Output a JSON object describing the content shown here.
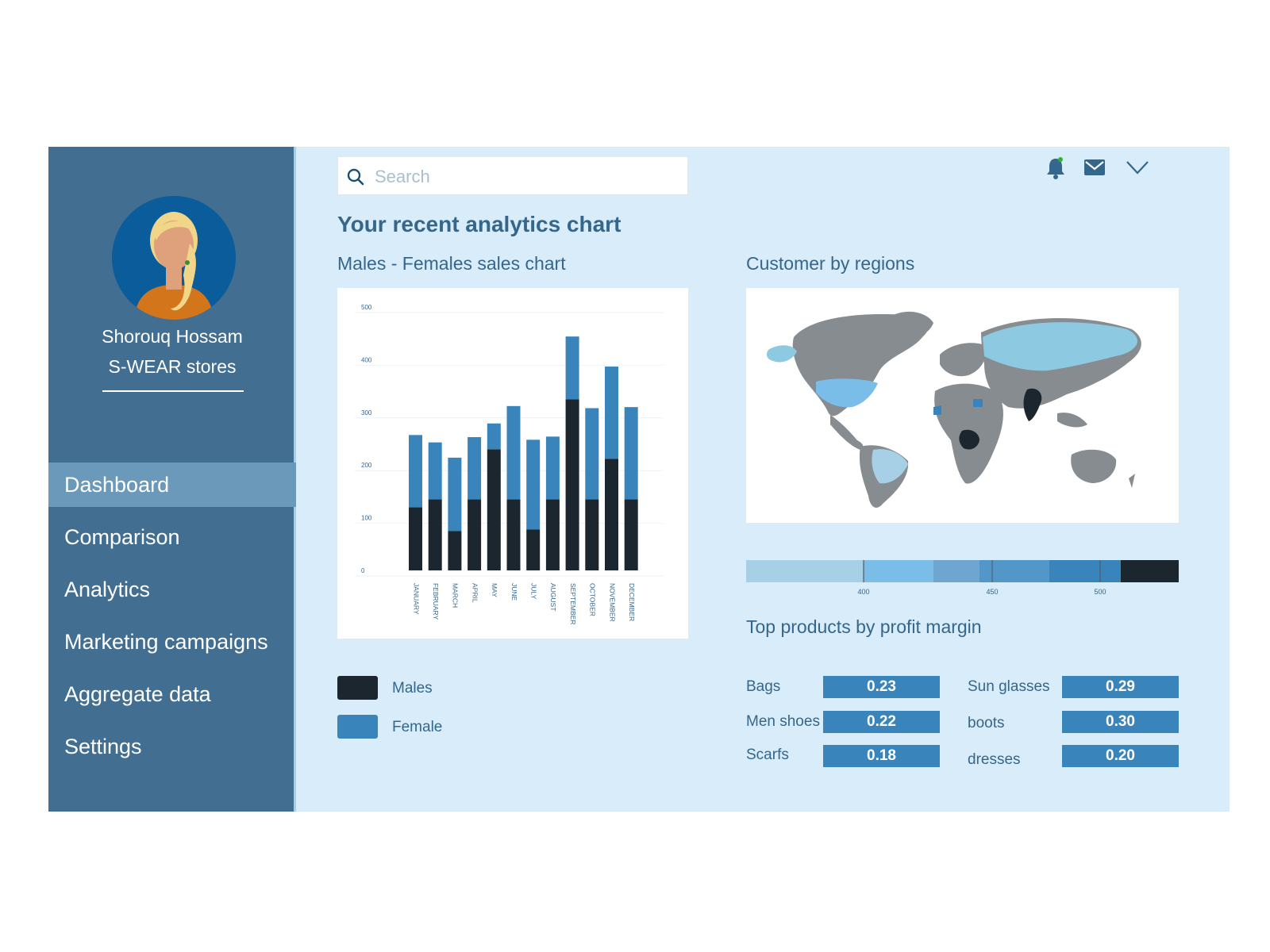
{
  "user": {
    "name": "Shorouq Hossam",
    "store": "S-WEAR stores"
  },
  "nav": {
    "items": [
      {
        "label": "Dashboard",
        "active": true
      },
      {
        "label": "Comparison",
        "active": false
      },
      {
        "label": "Analytics",
        "active": false
      },
      {
        "label": "Marketing campaigns",
        "active": false
      },
      {
        "label": "Aggregate data",
        "active": false
      },
      {
        "label": "Settings",
        "active": false
      }
    ]
  },
  "search": {
    "placeholder": "Search",
    "value": ""
  },
  "header_icons": [
    "bell-icon",
    "mail-icon",
    "chevron-down-icon"
  ],
  "page_title": "Your recent analytics chart",
  "sales_chart": {
    "title": "Males - Females sales chart"
  },
  "regions": {
    "title": "Customer by regions",
    "scale_ticks": [
      "400",
      "450",
      "500"
    ]
  },
  "legend": {
    "males": "Males",
    "female": "Female"
  },
  "products": {
    "title": "Top products by profit margin",
    "items": [
      {
        "name": "Bags",
        "value": "0.23"
      },
      {
        "name": "Men shoes",
        "value": "0.22"
      },
      {
        "name": "Scarfs",
        "value": "0.18"
      },
      {
        "name": "Sun glasses",
        "value": "0.29"
      },
      {
        "name": "boots",
        "value": "0.30"
      },
      {
        "name": "dresses",
        "value": "0.20"
      }
    ]
  },
  "colors": {
    "males": "#1c262e",
    "female": "#3a84bc",
    "sidebar": "#426f91",
    "background": "#d8ecf9",
    "accent_text": "#35668c",
    "notification_dot": "#2fb52f"
  },
  "chart_data": {
    "type": "bar",
    "stacked": true,
    "categories": [
      "JANUARY",
      "FEBRUARY",
      "MARCH",
      "APRIL",
      "MAY",
      "JUNE",
      "JULY",
      "AUGUST",
      "SEPTEMBER",
      "OCTOBER",
      "NOVEMBER",
      "DECEMBER"
    ],
    "series": [
      {
        "name": "Males",
        "values": [
          120,
          135,
          75,
          135,
          230,
          135,
          78,
          135,
          325,
          135,
          212,
          135
        ]
      },
      {
        "name": "Female",
        "values": [
          137,
          108,
          139,
          118,
          49,
          177,
          170,
          119,
          119,
          173,
          175,
          175
        ]
      }
    ],
    "yticks": [
      0,
      100,
      200,
      300,
      400,
      500
    ],
    "ylim": [
      0,
      500
    ],
    "title": "",
    "xlabel": "",
    "ylabel": "",
    "grid": true
  }
}
